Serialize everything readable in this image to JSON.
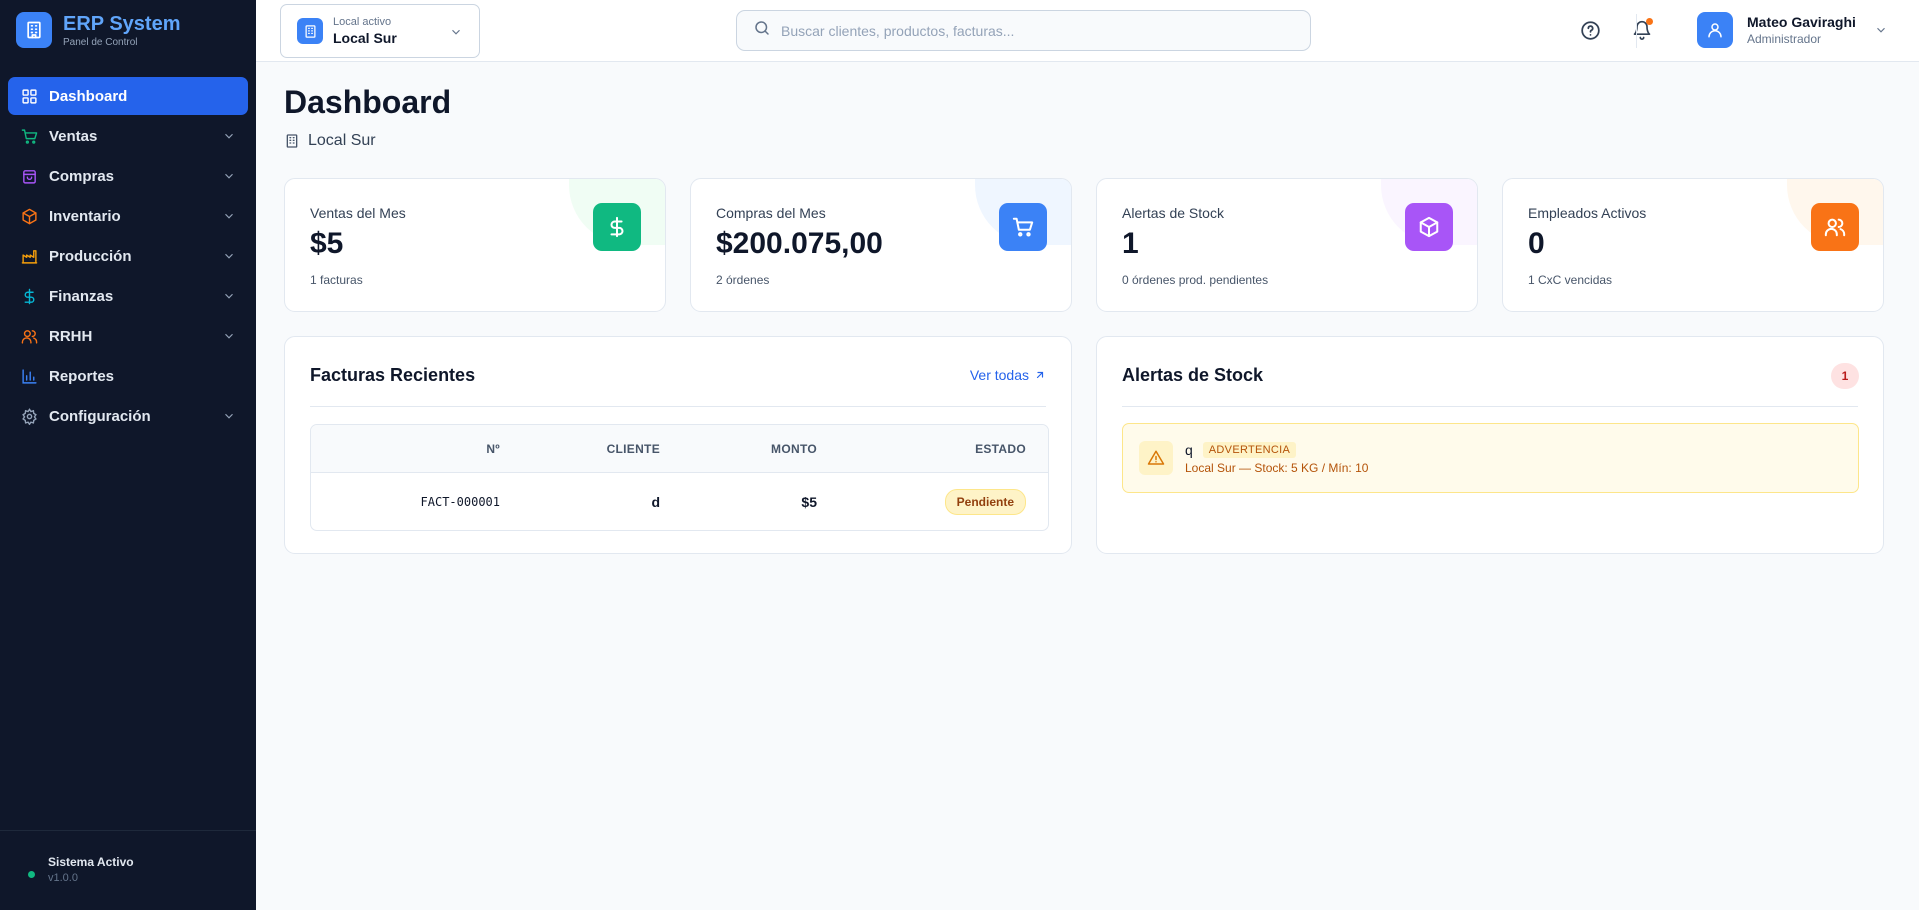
{
  "brand": {
    "title": "ERP System",
    "subtitle": "Panel de Control"
  },
  "sidebar": {
    "items": [
      {
        "label": "Dashboard",
        "icon": "grid-icon",
        "active": true
      },
      {
        "label": "Ventas",
        "icon": "cart-icon",
        "color": "#10b981"
      },
      {
        "label": "Compras",
        "icon": "bag-icon",
        "color": "#a855f7"
      },
      {
        "label": "Inventario",
        "icon": "box-icon",
        "color": "#f97316"
      },
      {
        "label": "Producción",
        "icon": "factory-icon",
        "color": "#f59e0b"
      },
      {
        "label": "Finanzas",
        "icon": "dollar-icon",
        "color": "#06b6d4"
      },
      {
        "label": "RRHH",
        "icon": "users-icon",
        "color": "#f97316"
      },
      {
        "label": "Reportes",
        "icon": "chart-icon",
        "color": "#3b82f6"
      },
      {
        "label": "Configuración",
        "icon": "gear-icon",
        "color": "#94a3b8"
      }
    ],
    "footer": {
      "status": "Sistema Activo",
      "version": "v1.0.0"
    }
  },
  "topbar": {
    "local_label": "Local activo",
    "local_value": "Local Sur",
    "search_placeholder": "Buscar clientes, productos, facturas...",
    "user_name": "Mateo Gaviraghi",
    "user_role": "Administrador"
  },
  "page": {
    "title": "Dashboard",
    "subtitle": "Local Sur"
  },
  "stats": [
    {
      "label": "Ventas del Mes",
      "value": "$5",
      "sub": "1 facturas",
      "icon": "dollar-icon",
      "color": "#10b981",
      "tint": "#f0fdf4"
    },
    {
      "label": "Compras del Mes",
      "value": "$200.075,00",
      "sub": "2 órdenes",
      "icon": "cart-icon",
      "color": "#3b82f6",
      "tint": "#eff6ff"
    },
    {
      "label": "Alertas de Stock",
      "value": "1",
      "sub": "0 órdenes prod. pendientes",
      "icon": "box-icon",
      "color": "#a855f7",
      "tint": "#faf5ff"
    },
    {
      "label": "Empleados Activos",
      "value": "0",
      "sub": "1 CxC vencidas",
      "icon": "users-icon",
      "color": "#f97316",
      "tint": "#fff7ed"
    }
  ],
  "invoices": {
    "title": "Facturas Recientes",
    "link": "Ver todas",
    "columns": [
      "Nº",
      "CLIENTE",
      "MONTO",
      "ESTADO"
    ],
    "rows": [
      {
        "number": "FACT-000001",
        "client": "d",
        "amount": "$5",
        "status": "Pendiente"
      }
    ]
  },
  "stock_alerts": {
    "title": "Alertas de Stock",
    "count": "1",
    "items": [
      {
        "name": "q",
        "level": "ADVERTENCIA",
        "detail": "Local Sur — Stock: 5 KG / Mín: 10"
      }
    ]
  }
}
